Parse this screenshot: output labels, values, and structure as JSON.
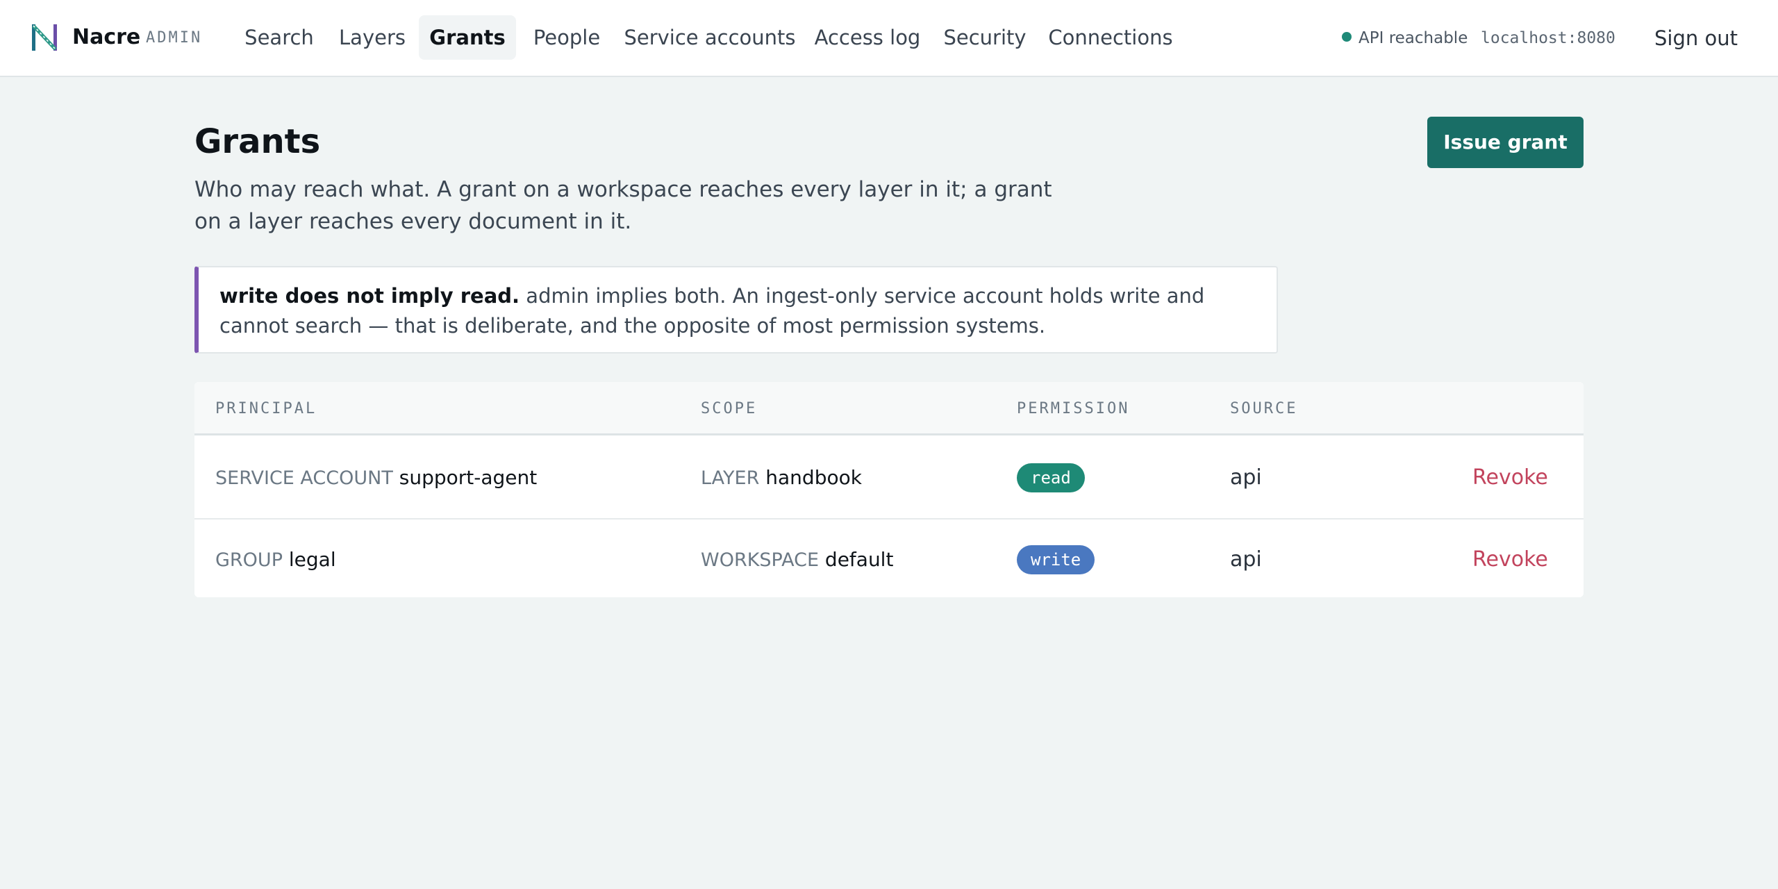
{
  "app": {
    "brand": "Nacre",
    "brand_sub": "ADMIN",
    "nav": [
      {
        "label": "Search"
      },
      {
        "label": "Layers"
      },
      {
        "label": "Grants"
      },
      {
        "label": "People"
      },
      {
        "label": "Service accounts"
      },
      {
        "label": "Access log"
      },
      {
        "label": "Security"
      },
      {
        "label": "Connections"
      }
    ],
    "active_nav": "Grants",
    "status_text": "API reachable",
    "host": "localhost:8080",
    "signout_label": "Sign out"
  },
  "page": {
    "title": "Grants",
    "description": "Who may reach what. A grant on a workspace reaches every layer in it; a grant on a layer reaches every document in it.",
    "issue_button": "Issue grant",
    "callout_strong": "write does not imply read.",
    "callout_text": "admin implies both. An ingest-only service account holds write and cannot search — that is deliberate, and the opposite of most permission systems."
  },
  "table": {
    "headers": [
      "PRINCIPAL",
      "SCOPE",
      "PERMISSION",
      "SOURCE"
    ],
    "rows": [
      {
        "principal_kind": "SERVICE ACCOUNT",
        "principal_name": "support-agent",
        "scope_kind": "LAYER",
        "scope_name": "handbook",
        "permission": "read",
        "source": "api",
        "action": "Revoke"
      },
      {
        "principal_kind": "GROUP",
        "principal_name": "legal",
        "scope_kind": "WORKSPACE",
        "scope_name": "default",
        "permission": "write",
        "source": "api",
        "action": "Revoke"
      }
    ]
  },
  "colors": {
    "accent": "#196e66",
    "status_ok": "#1f8a78",
    "permission_read": "#1e8a76",
    "permission_write": "#4a78c0",
    "revoke": "#c2445d",
    "callout_border": "#7d55b0"
  }
}
